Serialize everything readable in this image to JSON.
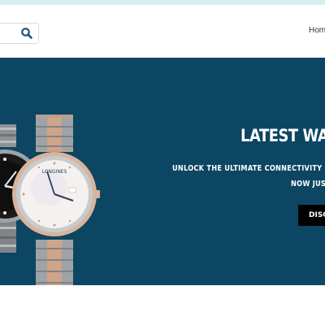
{
  "header": {
    "search": {
      "value": "",
      "placeholder": ""
    },
    "nav": {
      "home_label": "Hom"
    }
  },
  "hero": {
    "title": "LATEST WATC",
    "subtitle_line1": "UNLOCK THE ULTIMATE CONNECTIVITY EXPER",
    "subtitle_line2": "NOW JUST",
    "cta_label": "DISCO",
    "watch_brand": "LONGINES",
    "background_color": "#0d4662"
  },
  "icons": {
    "search": "search-icon"
  }
}
